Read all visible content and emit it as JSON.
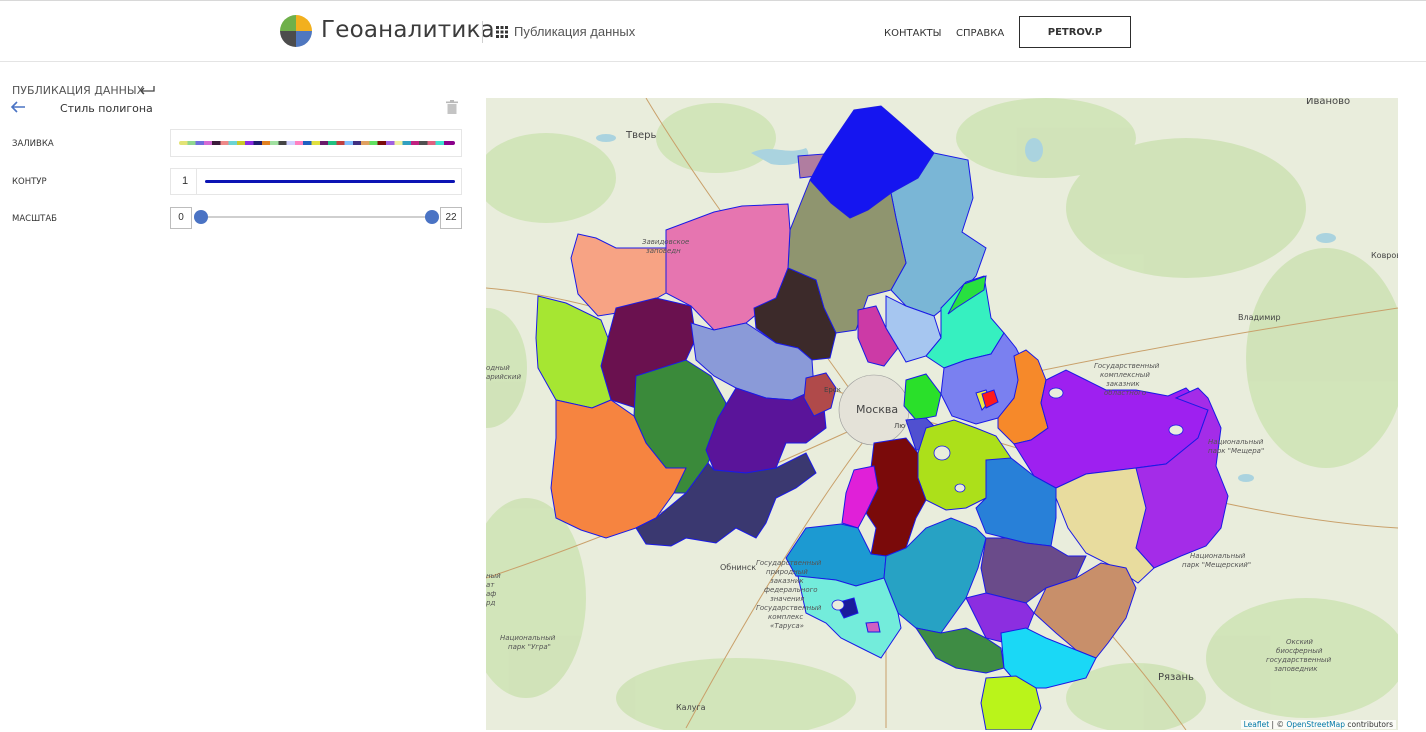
{
  "header": {
    "brand": "Геоаналитика",
    "section": "Публикация данных",
    "nav": [
      "КОНТАКТЫ",
      "СПРАВКА"
    ],
    "user": "PETROV.P"
  },
  "panel": {
    "title": "ПУБЛИКАЦИЯ ДАННЫХ",
    "style_title": "Стиль полигона",
    "fill_label": "ЗАЛИВКА",
    "contour_label": "КОНТУР",
    "contour_width": "1",
    "contour_color": "#0c14b4",
    "scale_label": "МАСШТАБ",
    "scale_min": "0",
    "scale_max": "22"
  },
  "map": {
    "labels": {
      "tver": "Тверь",
      "ivanovo": "Иваново",
      "kovrov": "Ковров",
      "vladimir": "Владимир",
      "moskva": "Москва",
      "obninsk": "Обнинск",
      "kaluga": "Калуга",
      "ryazan": "Рязань",
      "zavidovo_1": "Завидовское",
      "zavidovo_2": "заповедн",
      "west_1": "одный",
      "west_2": "арийский",
      "zakaznik_1": "Государственный",
      "zakaznik_2": "комплексный",
      "zakaznik_3": "заказник",
      "zakaznik_4": "областного",
      "meshchera_1": "Национальный",
      "meshchera_2": "парк \"Мещера\"",
      "meshcherskiy_1": "Национальный",
      "meshcherskiy_2": "парк \"Мещерский\"",
      "ugra_1": "Национальный",
      "ugra_2": "парк \"Угра\"",
      "oka_1": "Окский",
      "oka_2": "биосферный",
      "oka_3": "государственный",
      "oka_4": "заповедник",
      "tarusa_1": "Государственный",
      "tarusa_2": "природный",
      "tarusa_3": "заказник",
      "tarusa_4": "федерального",
      "tarusa_5": "значения",
      "tarusa_6": "Государственный",
      "tarusa_7": "комплекс",
      "tarusa_8": "«Таруса»",
      "left_1": "ный",
      "left_2": "ат",
      "left_3": "аф",
      "left_4": "рд",
      "ersk": "Ерск",
      "lyu": "Лю"
    },
    "attribution_leaflet": "Leaflet",
    "attribution_sep": " | © ",
    "attribution_osm": "OpenStreetMap",
    "attribution_tail": " contributors"
  }
}
